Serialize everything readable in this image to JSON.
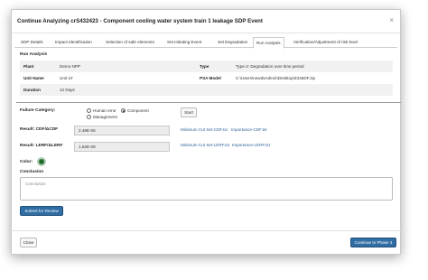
{
  "modal": {
    "title": "Continue Analyzing crS432423 - Component cooling water system train 1 leakage SDP Event",
    "close_icon": "×"
  },
  "tabs": [
    {
      "label": "SDP Details",
      "active": false
    },
    {
      "label": "Impact Identification",
      "active": false
    },
    {
      "label": "Selection of safe elements",
      "active": false
    },
    {
      "label": "Set Initiating Event",
      "active": false
    },
    {
      "label": "Set Degradation",
      "active": false
    },
    {
      "label": "Run Analysis",
      "active": true
    },
    {
      "label": "Verification/Adjustment of risk level",
      "active": false
    }
  ],
  "run_analysis": {
    "section_title": "Run Analysis",
    "info": {
      "plant_label": "Plant",
      "plant_value": "Demo NPP",
      "type_label": "Type",
      "type_value": "Type 2: Degradation over time period",
      "unit_label": "Unit Name",
      "unit_value": "Unit 1#",
      "psa_label": "PSA Model",
      "psa_value": "C:\\Users\\newdsAdmin\\Desktop\\Z345DF.zip",
      "duration_label": "Duration",
      "duration_value": "12 Days"
    },
    "failure_category_label": "Failure Category:",
    "options": {
      "human_error": "Human error",
      "component": "Component",
      "management": "Management",
      "selected": "component"
    },
    "start_label": "Start",
    "cdf_label": "Result: CDF/ΔCDF",
    "cdf_value": "2.48E-06",
    "lerf_label": "Result: LERF/ΔLERF",
    "lerf_value": "1.52E-09",
    "cdf_links": {
      "min_cut": "Minimum Cut Set-CDF.txt",
      "importance": "Importance-CDF.txt"
    },
    "lerf_links": {
      "min_cut": "Minimum Cut Set-LERF.txt",
      "importance": "Importance-LERF.txt"
    },
    "color_label": "Color:",
    "color_value": "#1f6b2a",
    "conclusion_label": "Conclusion",
    "conclusion_placeholder": "Conclusion",
    "submit_label": "Submit for Review"
  },
  "footer": {
    "close_label": "Close",
    "continue_label": "Continue to Phase 3"
  }
}
